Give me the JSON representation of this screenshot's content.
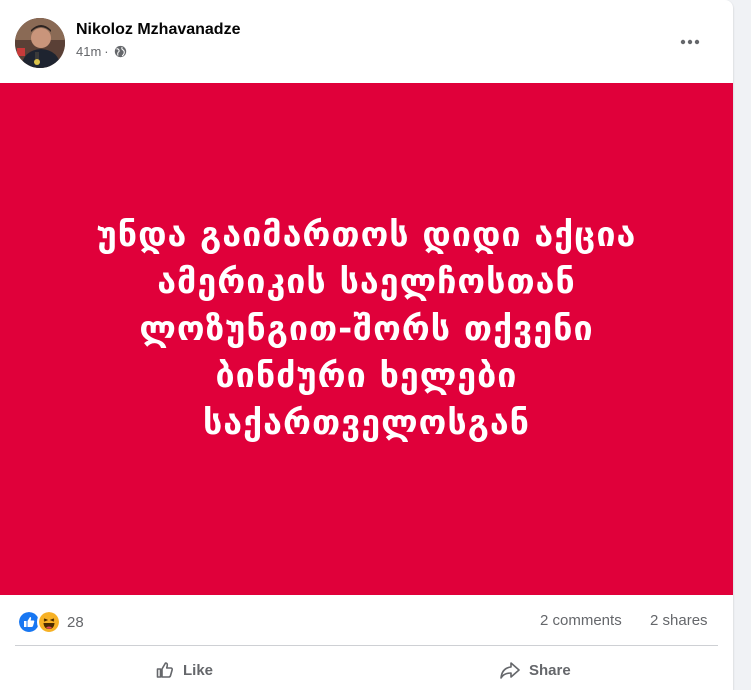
{
  "post": {
    "author": "Nikoloz Mzhavanadze",
    "time": "41m",
    "separator": "·",
    "privacy_icon": "globe-icon",
    "more_icon": "more-horizontal-icon"
  },
  "banner": {
    "background": "#e0003a",
    "lines": [
      "უნდა გაიმართოს დიდი აქცია",
      "ამერიკის საელჩოსთან",
      "ლოზუნგით-შორს თქვენი",
      "ბინძური ხელები",
      "საქართველოსგან"
    ]
  },
  "stats": {
    "reaction_icons": [
      "like-icon",
      "haha-icon"
    ],
    "reaction_count": "28",
    "comments": "2 comments",
    "shares": "2 shares"
  },
  "actions": {
    "like_label": "Like",
    "share_label": "Share"
  }
}
